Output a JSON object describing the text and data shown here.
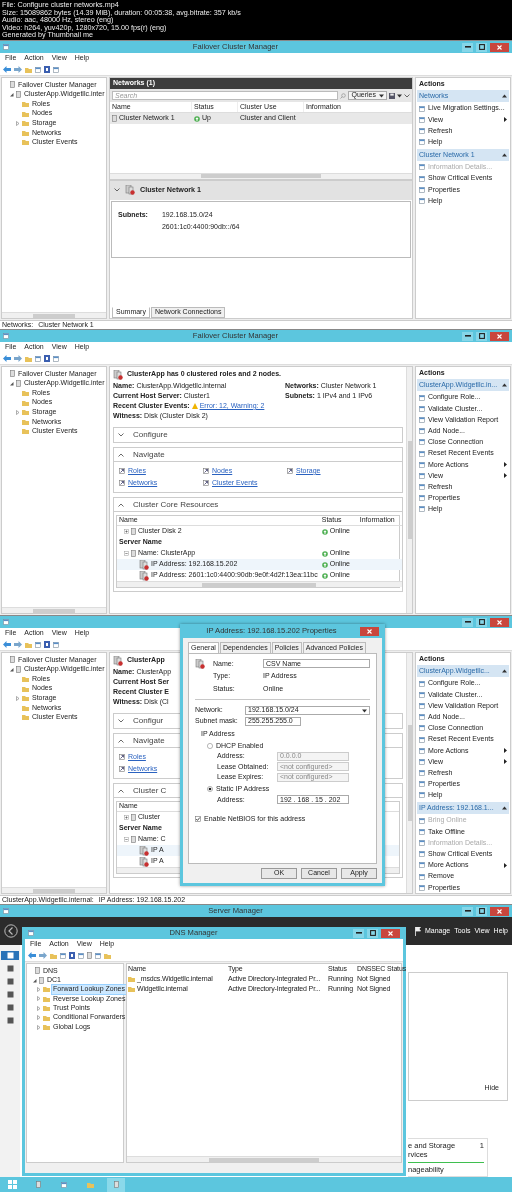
{
  "header": {
    "lines": [
      "File: Configure cluster networks.mp4",
      "Size: 15089862 bytes (14.39 MiB), duration: 00:05:38, avg.bitrate: 357 kb/s",
      "Audio: aac, 48000 Hz, stereo (eng)",
      "Video: h264, yuv420p, 1280x720, 15.00 fps(r) (eng)",
      "Generated by Thumbnail me"
    ]
  },
  "frames": [
    {
      "kind": "cluster_manager",
      "title": "Failover Cluster Manager",
      "menu": [
        "File",
        "Action",
        "View",
        "Help"
      ],
      "tree": [
        {
          "label": "Failover Cluster Manager",
          "children": [
            {
              "label": "ClusterApp.Widgetllc.inter",
              "expanded": true,
              "children": [
                {
                  "label": "Roles"
                },
                {
                  "label": "Nodes"
                },
                {
                  "label": "Storage",
                  "expanded": false
                },
                {
                  "label": "Networks"
                },
                {
                  "label": "Cluster Events"
                }
              ]
            }
          ]
        }
      ],
      "center": {
        "kind": "networks",
        "title": "Networks (1)",
        "search": {
          "placeholder": "Search"
        },
        "queries": "Queries",
        "columns": [
          "Name",
          "Status",
          "Cluster Use",
          "Information"
        ],
        "rows": [
          {
            "cells": [
              "Cluster Network 1",
              "Up",
              "Cluster and Client"
            ],
            "selected": true
          }
        ],
        "details": {
          "title": "Cluster Network 1",
          "label": "Subnets:",
          "values": [
            "192.168.15.0/24",
            "2601:1c0:4400:90db::/64"
          ],
          "tabs": [
            {
              "label": "Summary",
              "selected": true
            },
            {
              "label": "Network Connections",
              "selected": false
            }
          ]
        }
      },
      "actions": {
        "title": "Actions",
        "sections": [
          {
            "title": "Networks",
            "items": [
              {
                "label": "Live Migration Settings...",
                "disabled": false,
                "submenu": false
              },
              {
                "label": "View",
                "disabled": false,
                "submenu": true
              },
              {
                "label": "Refresh",
                "disabled": false,
                "submenu": false
              },
              {
                "label": "Help",
                "disabled": false,
                "submenu": false
              }
            ]
          },
          {
            "title": "Cluster Network 1",
            "items": [
              {
                "label": "Information Details...",
                "disabled": true,
                "submenu": false
              },
              {
                "label": "Show Critical Events",
                "disabled": false,
                "submenu": false
              },
              {
                "label": "Properties",
                "disabled": false,
                "submenu": false
              },
              {
                "label": "Help",
                "disabled": false,
                "submenu": false
              }
            ]
          }
        ]
      },
      "status_bar": [
        "Networks:",
        "Cluster Network 1"
      ]
    },
    {
      "kind": "cluster_manager",
      "title": "Failover Cluster Manager",
      "menu": [
        "File",
        "Action",
        "View",
        "Help"
      ],
      "tree": [
        {
          "label": "Failover Cluster Manager",
          "children": [
            {
              "label": "ClusterApp.Widgetllc.inter",
              "expanded": true,
              "children": [
                {
                  "label": "Roles"
                },
                {
                  "label": "Nodes"
                },
                {
                  "label": "Storage",
                  "expanded": false
                },
                {
                  "label": "Networks"
                },
                {
                  "label": "Cluster Events"
                }
              ]
            }
          ]
        }
      ],
      "center": {
        "kind": "summary",
        "heading": "ClusterApp has 0 clustered roles and 2 nodes.",
        "info": [
          {
            "label": "Name:",
            "value": "ClusterApp.Widgetllc.internal"
          },
          {
            "label": "Current Host Server:",
            "value": "Cluster1"
          },
          {
            "label": "Recent Cluster Events:",
            "value": "Error: 12, Warning: 2",
            "kind": "warning_link"
          },
          {
            "label": "Witness:",
            "value": "Disk (Cluster Disk 2)"
          }
        ],
        "info_right": [
          {
            "label": "Networks:",
            "value": "Cluster Network 1"
          },
          {
            "label": "Subnets:",
            "value": "1 IPv4 and 1 IPv6"
          }
        ],
        "sections": [
          {
            "title": "Configure",
            "expanded": false
          },
          {
            "title": "Navigate",
            "expanded": true,
            "links": [
              "Roles",
              "Networks",
              "Nodes",
              "Cluster Events",
              "Storage"
            ]
          },
          {
            "title": "Cluster Core Resources",
            "expanded": true,
            "table": {
              "columns": [
                "Name",
                "Status",
                "Information"
              ],
              "rows": [
                {
                  "kind": "item",
                  "label": "Cluster Disk 2",
                  "status": "Online",
                  "expanded": false,
                  "selected": false
                },
                {
                  "kind": "group",
                  "label": "Server Name",
                  "selected": false
                },
                {
                  "kind": "item",
                  "label": "Name: ClusterApp",
                  "status": "Online",
                  "expanded": true,
                  "selected": false
                },
                {
                  "kind": "child",
                  "label": "IP Address: 192.168.15.202",
                  "status": "Online",
                  "selected": true
                },
                {
                  "kind": "child",
                  "label": "IP Address: 2601:1c0:4400:90db:9e0f:4d2f:13ea:11bc",
                  "status": "Online",
                  "selected": false
                }
              ]
            }
          }
        ]
      },
      "actions": {
        "title": "Actions",
        "sections": [
          {
            "title": "ClusterApp.Widgetllc.in...",
            "items": [
              {
                "label": "Configure Role...",
                "disabled": false,
                "submenu": false
              },
              {
                "label": "Validate Cluster...",
                "disabled": false,
                "submenu": false
              },
              {
                "label": "View Validation Report",
                "disabled": false,
                "submenu": false
              },
              {
                "label": "Add Node...",
                "disabled": false,
                "submenu": false
              },
              {
                "label": "Close Connection",
                "disabled": false,
                "submenu": false
              },
              {
                "label": "Reset Recent Events",
                "disabled": false,
                "submenu": false
              },
              {
                "label": "More Actions",
                "disabled": false,
                "submenu": true
              },
              {
                "label": "View",
                "disabled": false,
                "submenu": true
              },
              {
                "label": "Refresh",
                "disabled": false,
                "submenu": false
              },
              {
                "label": "Properties",
                "disabled": false,
                "submenu": false
              },
              {
                "label": "Help",
                "disabled": false,
                "submenu": false
              }
            ]
          }
        ]
      }
    },
    {
      "kind": "cluster_manager",
      "menu": [
        "File",
        "Action",
        "View",
        "Help"
      ],
      "tree": [
        {
          "label": "Failover Cluster Manager",
          "children": [
            {
              "label": "ClusterApp.Widgetllc.inter",
              "expanded": true,
              "children": [
                {
                  "label": "Roles"
                },
                {
                  "label": "Nodes"
                },
                {
                  "label": "Storage",
                  "expanded": false
                },
                {
                  "label": "Networks"
                },
                {
                  "label": "Cluster Events"
                }
              ]
            }
          ]
        }
      ],
      "center": {
        "kind": "summary",
        "heading": "ClusterApp",
        "info": [
          {
            "label": "Name:",
            "value": "ClusterApp"
          },
          {
            "label": "Current Host Ser"
          },
          {
            "label": "Recent Cluster E"
          },
          {
            "label": "Witness:",
            "value": "Disk (Cl"
          }
        ],
        "sections": [
          {
            "title": "Configur",
            "expanded": false
          },
          {
            "title": "Navigate",
            "expanded": true,
            "links": [
              "Roles",
              "Networks"
            ]
          },
          {
            "title": "Cluster C",
            "expanded": true,
            "table": {
              "columns": [
                "Name"
              ],
              "rows": [
                {
                  "kind": "item",
                  "label": "Cluster",
                  "expanded": false,
                  "selected": false
                },
                {
                  "kind": "group",
                  "label": "Server Name",
                  "selected": false
                },
                {
                  "kind": "item",
                  "label": "Name: C",
                  "expanded": true,
                  "selected": false
                },
                {
                  "kind": "child",
                  "label": "IP A",
                  "selected": true
                },
                {
                  "kind": "child",
                  "label": "IP A",
                  "selected": false
                }
              ]
            }
          }
        ]
      },
      "actions": {
        "title": "Actions",
        "sections": [
          {
            "title": "ClusterApp.Widgetllc...",
            "items": [
              {
                "label": "Configure Role...",
                "disabled": false,
                "submenu": false
              },
              {
                "label": "Validate Cluster...",
                "disabled": false,
                "submenu": false
              },
              {
                "label": "View Validation Report",
                "disabled": false,
                "submenu": false
              },
              {
                "label": "Add Node...",
                "disabled": false,
                "submenu": false
              },
              {
                "label": "Close Connection",
                "disabled": false,
                "submenu": false
              },
              {
                "label": "Reset Recent Events",
                "disabled": false,
                "submenu": false
              },
              {
                "label": "More Actions",
                "disabled": false,
                "submenu": true
              },
              {
                "label": "View",
                "disabled": false,
                "submenu": true
              },
              {
                "label": "Refresh",
                "disabled": false,
                "submenu": false
              },
              {
                "label": "Properties",
                "disabled": false,
                "submenu": false
              },
              {
                "label": "Help",
                "disabled": false,
                "submenu": false
              }
            ]
          },
          {
            "title": "IP Address: 192.168.1...",
            "items": [
              {
                "label": "Bring Online",
                "disabled": true,
                "submenu": false
              },
              {
                "label": "Take Offline",
                "disabled": false,
                "submenu": false
              },
              {
                "label": "Information Details...",
                "disabled": true,
                "submenu": false
              },
              {
                "label": "Show Critical Events",
                "disabled": false,
                "submenu": false
              },
              {
                "label": "More Actions",
                "disabled": false,
                "submenu": true
              },
              {
                "label": "Remove",
                "disabled": false,
                "submenu": false
              },
              {
                "label": "Properties",
                "disabled": false,
                "submenu": false
              }
            ]
          }
        ]
      },
      "dialog": {
        "title": "IP Address: 192.168.15.202 Properties",
        "tabs": [
          {
            "label": "General",
            "selected": true
          },
          {
            "label": "Dependencies",
            "selected": false
          },
          {
            "label": "Policies",
            "selected": false
          },
          {
            "label": "Advanced Policies",
            "selected": false
          }
        ],
        "name": {
          "label": "Name:",
          "value": "CSV Name"
        },
        "props": [
          {
            "label": "Type:",
            "value": "IP Address"
          },
          {
            "label": "Status:",
            "value": "Online"
          }
        ],
        "network": {
          "label": "Network:",
          "value": "192.168.15.0/24"
        },
        "subnet": {
          "label": "Subnet mask:",
          "value": "255.255.255.0"
        },
        "group": {
          "title": "IP Address",
          "options": [
            {
              "label": "DHCP Enabled",
              "selected": false,
              "fields": [
                {
                  "label": "Address:",
                  "value": "0.0.0.0",
                  "disabled": true
                },
                {
                  "label": "Lease Obtained:",
                  "value": "<not configured>",
                  "disabled": true
                },
                {
                  "label": "Lease Expires:",
                  "value": "<not configured>",
                  "disabled": true
                }
              ]
            },
            {
              "label": "Static IP Address",
              "selected": true,
              "fields": [
                {
                  "label": "Address:",
                  "value": "192 . 168 . 15 . 202",
                  "disabled": false
                }
              ]
            }
          ]
        },
        "checkbox": {
          "label": "Enable NetBIOS for this address",
          "checked": true
        },
        "buttons": [
          "OK",
          "Cancel",
          "Apply"
        ]
      },
      "status_bar": [
        "ClusterApp.Widgetllc.internal:",
        "IP Address: 192.168.15.202"
      ]
    },
    {
      "kind": "server_manager",
      "title": "Server Manager",
      "menu": [
        "Manage",
        "Tools",
        "View",
        "Help"
      ],
      "sidebar": [
        {
          "selected": true
        },
        {
          "selected": false
        },
        {
          "selected": false
        },
        {
          "selected": false
        },
        {
          "selected": false
        },
        {
          "selected": false
        }
      ],
      "hide": "Hide",
      "tile": {
        "lines": [
          "e and Storage",
          "rvices"
        ],
        "count": "1",
        "footer": "nageability"
      },
      "dns": {
        "title": "DNS Manager",
        "menu": [
          "File",
          "Action",
          "View",
          "Help"
        ],
        "tree": [
          {
            "label": "DNS",
            "selected": false,
            "children": [
              {
                "label": "DC1",
                "expanded": true,
                "selected": false,
                "children": [
                  {
                    "label": "Forward Lookup Zones",
                    "expanded": false,
                    "selected": true
                  },
                  {
                    "label": "Reverse Lookup Zones",
                    "expanded": false,
                    "selected": false
                  },
                  {
                    "label": "Trust Points",
                    "expanded": false,
                    "selected": false
                  },
                  {
                    "label": "Conditional Forwarders",
                    "expanded": false,
                    "selected": false
                  },
                  {
                    "label": "Global Logs",
                    "expanded": false,
                    "selected": false
                  }
                ]
              }
            ]
          }
        ],
        "columns": [
          "Name",
          "Type",
          "Status",
          "DNSSEC Status"
        ],
        "rows": [
          [
            "_msdcs.Widgetllc.internal",
            "Active Directory-Integrated Pr...",
            "Running",
            "Not Signed"
          ],
          [
            "Widgetllc.internal",
            "Active Directory-Integrated Pr...",
            "Running",
            "Not Signed"
          ]
        ]
      }
    }
  ]
}
